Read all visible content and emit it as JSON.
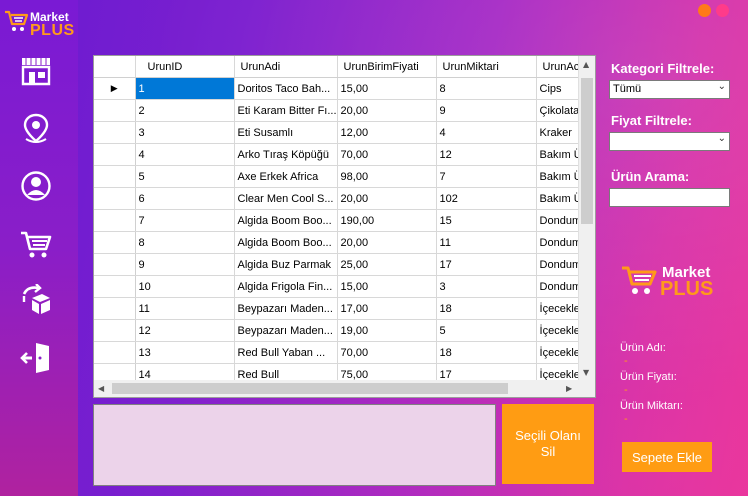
{
  "app": {
    "logo_market": "Market",
    "logo_plus": "PLUS",
    "accent": "#ff9c13",
    "selection": "#0078d7"
  },
  "sidebar": {
    "items": [
      {
        "icon": "store-icon"
      },
      {
        "icon": "location-pin-icon"
      },
      {
        "icon": "user-icon"
      },
      {
        "icon": "cart-icon"
      },
      {
        "icon": "return-box-icon"
      },
      {
        "icon": "logout-icon"
      }
    ]
  },
  "grid": {
    "columns": [
      "UrunID",
      "UrunAdi",
      "UrunBirimFiyati",
      "UrunMiktari",
      "UrunAc"
    ],
    "rows": [
      [
        "1",
        "Doritos Taco Bah...",
        "15,00",
        "8",
        "Cips"
      ],
      [
        "2",
        "Eti Karam Bitter Fı...",
        "20,00",
        "9",
        "Çikolata"
      ],
      [
        "3",
        "Eti Susamlı",
        "12,00",
        "4",
        "Kraker"
      ],
      [
        "4",
        "Arko Tıraş Köpüğü",
        "70,00",
        "12",
        "Bakım Ü"
      ],
      [
        "5",
        "Axe Erkek Africa",
        "98,00",
        "7",
        "Bakım Ü"
      ],
      [
        "6",
        "Clear Men Cool S...",
        "20,00",
        "102",
        "Bakım Ü"
      ],
      [
        "7",
        "Algida Boom Boo...",
        "190,00",
        "15",
        "Dondum"
      ],
      [
        "8",
        "Algida Boom Boo...",
        "20,00",
        "11",
        "Dondum"
      ],
      [
        "9",
        "Algida Buz Parmak",
        "25,00",
        "17",
        "Dondum"
      ],
      [
        "10",
        "Algida Frigola Fin...",
        "15,00",
        "3",
        "Dondum"
      ],
      [
        "11",
        "Beypazarı Maden...",
        "17,00",
        "18",
        "İçecekle"
      ],
      [
        "12",
        "Beypazarı Maden...",
        "19,00",
        "5",
        "İçecekle"
      ],
      [
        "13",
        "Red Bull Yaban ...",
        "70,00",
        "18",
        "İçecekle"
      ],
      [
        "14",
        "Red Bull",
        "75,00",
        "17",
        "İçecekle"
      ]
    ],
    "current_row_marker": "▶"
  },
  "actions": {
    "delete_selected": "Seçili Olanı Sil",
    "add_to_cart": "Sepete Ekle"
  },
  "filters": {
    "category_label": "Kategori Filtrele:",
    "category_value": "Tümü",
    "price_label": "Fiyat Filtrele:",
    "price_value": "",
    "search_label": "Ürün Arama:",
    "search_value": ""
  },
  "details": {
    "name_label": "Ürün Adı:",
    "name_value": "-",
    "price_label": "Ürün Fiyatı:",
    "price_value": "-",
    "qty_label": "Ürün Miktarı:",
    "qty_value": "-"
  }
}
